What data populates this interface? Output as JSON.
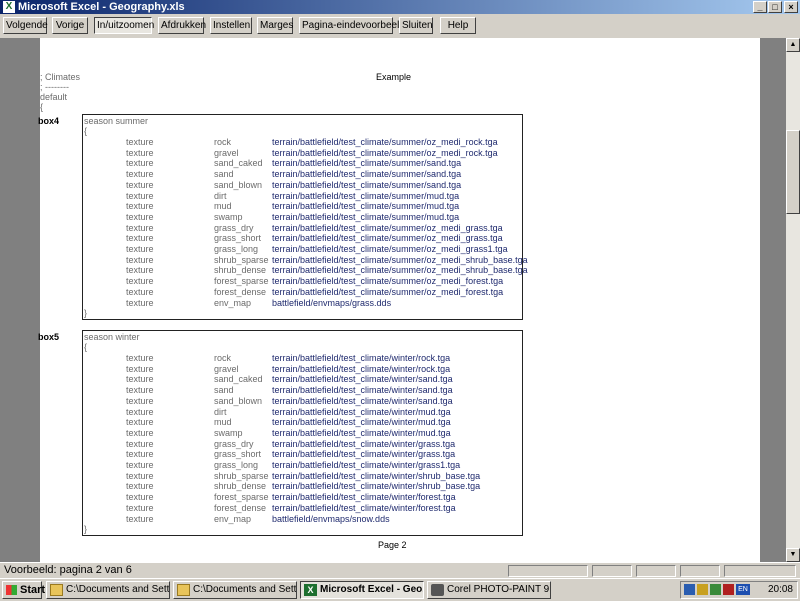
{
  "window": {
    "title": "Microsoft Excel - Geography.xls",
    "app_icon": "X",
    "controls": {
      "minimize": "_",
      "maximize": "□",
      "close": "×"
    }
  },
  "toolbar": {
    "buttons": [
      "Volgende",
      "Vorige",
      "In/uitzoomen",
      "Afdrukken",
      "Instellen",
      "Marges",
      "Pagina-eindevoorbeeld",
      "Sluiten",
      "Help"
    ]
  },
  "page": {
    "header_text": "Example",
    "comment_lines": [
      "; Climates",
      "; --------",
      "default",
      "{"
    ],
    "footer": "Page 2",
    "boxes": [
      {
        "label": "box4",
        "season": "season summer",
        "open": "{",
        "close": "}",
        "rows": [
          [
            "texture",
            "rock",
            "terrain/battlefield/test_climate/summer/oz_medi_rock.tga"
          ],
          [
            "texture",
            "gravel",
            "terrain/battlefield/test_climate/summer/oz_medi_rock.tga"
          ],
          [
            "texture",
            "sand_caked",
            "terrain/battlefield/test_climate/summer/sand.tga"
          ],
          [
            "texture",
            "sand",
            "terrain/battlefield/test_climate/summer/sand.tga"
          ],
          [
            "texture",
            "sand_blown",
            "terrain/battlefield/test_climate/summer/sand.tga"
          ],
          [
            "texture",
            "dirt",
            "terrain/battlefield/test_climate/summer/mud.tga"
          ],
          [
            "texture",
            "mud",
            "terrain/battlefield/test_climate/summer/mud.tga"
          ],
          [
            "texture",
            "swamp",
            "terrain/battlefield/test_climate/summer/mud.tga"
          ],
          [
            "texture",
            "grass_dry",
            "terrain/battlefield/test_climate/summer/oz_medi_grass.tga"
          ],
          [
            "texture",
            "grass_short",
            "terrain/battlefield/test_climate/summer/oz_medi_grass.tga"
          ],
          [
            "texture",
            "grass_long",
            "terrain/battlefield/test_climate/summer/oz_medi_grass1.tga"
          ],
          [
            "texture",
            "shrub_sparse",
            "terrain/battlefield/test_climate/summer/oz_medi_shrub_base.tga"
          ],
          [
            "texture",
            "shrub_dense",
            "terrain/battlefield/test_climate/summer/oz_medi_shrub_base.tga"
          ],
          [
            "texture",
            "forest_sparse",
            "terrain/battlefield/test_climate/summer/oz_medi_forest.tga"
          ],
          [
            "texture",
            "forest_dense",
            "terrain/battlefield/test_climate/summer/oz_medi_forest.tga"
          ],
          [
            "texture",
            "env_map",
            "battlefield/envmaps/grass.dds"
          ]
        ]
      },
      {
        "label": "box5",
        "season": "season winter",
        "open": "{",
        "close": "}",
        "rows": [
          [
            "texture",
            "rock",
            "terrain/battlefield/test_climate/winter/rock.tga"
          ],
          [
            "texture",
            "gravel",
            "terrain/battlefield/test_climate/winter/rock.tga"
          ],
          [
            "texture",
            "sand_caked",
            "terrain/battlefield/test_climate/winter/sand.tga"
          ],
          [
            "texture",
            "sand",
            "terrain/battlefield/test_climate/winter/sand.tga"
          ],
          [
            "texture",
            "sand_blown",
            "terrain/battlefield/test_climate/winter/sand.tga"
          ],
          [
            "texture",
            "dirt",
            "terrain/battlefield/test_climate/winter/mud.tga"
          ],
          [
            "texture",
            "mud",
            "terrain/battlefield/test_climate/winter/mud.tga"
          ],
          [
            "texture",
            "swamp",
            "terrain/battlefield/test_climate/winter/mud.tga"
          ],
          [
            "texture",
            "grass_dry",
            "terrain/battlefield/test_climate/winter/grass.tga"
          ],
          [
            "texture",
            "grass_short",
            "terrain/battlefield/test_climate/winter/grass.tga"
          ],
          [
            "texture",
            "grass_long",
            "terrain/battlefield/test_climate/winter/grass1.tga"
          ],
          [
            "texture",
            "shrub_sparse",
            "terrain/battlefield/test_climate/winter/shrub_base.tga"
          ],
          [
            "texture",
            "shrub_dense",
            "terrain/battlefield/test_climate/winter/shrub_base.tga"
          ],
          [
            "texture",
            "forest_sparse",
            "terrain/battlefield/test_climate/winter/forest.tga"
          ],
          [
            "texture",
            "forest_dense",
            "terrain/battlefield/test_climate/winter/forest.tga"
          ],
          [
            "texture",
            "env_map",
            "battlefield/envmaps/snow.dds"
          ]
        ]
      }
    ]
  },
  "status": {
    "text": "Voorbeeld: pagina 2 van 6"
  },
  "taskbar": {
    "start_label": "Start",
    "tasks": [
      {
        "label": "C:\\Documents and Settin...",
        "icon": "folder-icon",
        "active": false
      },
      {
        "label": "C:\\Documents and Settin...",
        "icon": "folder-icon",
        "active": false
      },
      {
        "label": "Microsoft Excel - Geo...",
        "icon": "excel-icon",
        "active": true
      },
      {
        "label": "Corel PHOTO-PAINT 9",
        "icon": "camera-icon",
        "active": false
      }
    ],
    "tray_badge": "EN",
    "clock": "20:08"
  },
  "colors": {
    "title_gradient_start": "#0a246a",
    "title_gradient_end": "#a6caf0",
    "path_text": "#1f2a6e",
    "canvas": "#808080"
  }
}
